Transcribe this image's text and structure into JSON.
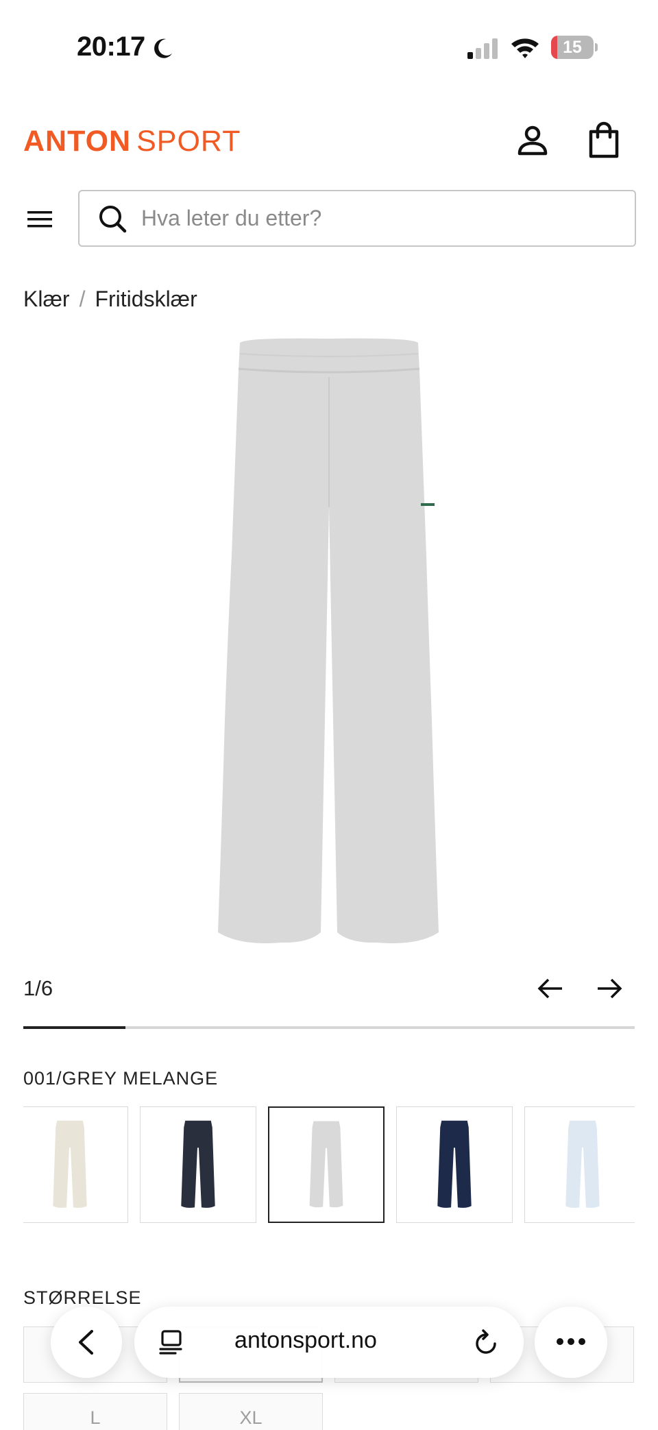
{
  "status_bar": {
    "time": "20:17",
    "battery_percent": "15",
    "battery_level": 0.15,
    "battery_color": "#e5484d",
    "icons": [
      "moon-icon",
      "signal-icon",
      "wifi-icon",
      "battery-icon"
    ]
  },
  "header": {
    "logo_part1": "ANTON",
    "logo_part2": "SPORT",
    "brand_color": "#f15a22",
    "icons": [
      "account-icon",
      "shopping-bag-icon",
      "menu-icon"
    ]
  },
  "search": {
    "placeholder": "Hva leter du etter?",
    "value": ""
  },
  "breadcrumb": {
    "items": [
      "Klær",
      "Fritidsklær"
    ],
    "separator": "/"
  },
  "gallery": {
    "counter": "1/6",
    "current": 1,
    "total": 6,
    "progress": 0.1667
  },
  "color": {
    "label": "001/GREY MELANGE",
    "swatches": [
      {
        "color": "#e9e4d8"
      },
      {
        "color": "#2a2f3e"
      },
      {
        "color": "#d9d9d9",
        "selected": true
      },
      {
        "color": "#1e2a4a"
      },
      {
        "color": "#dde8f2"
      }
    ]
  },
  "size": {
    "label": "STØRRELSE",
    "sizes": [
      "L",
      "XL"
    ]
  },
  "browser": {
    "url": "antonsport.no"
  }
}
